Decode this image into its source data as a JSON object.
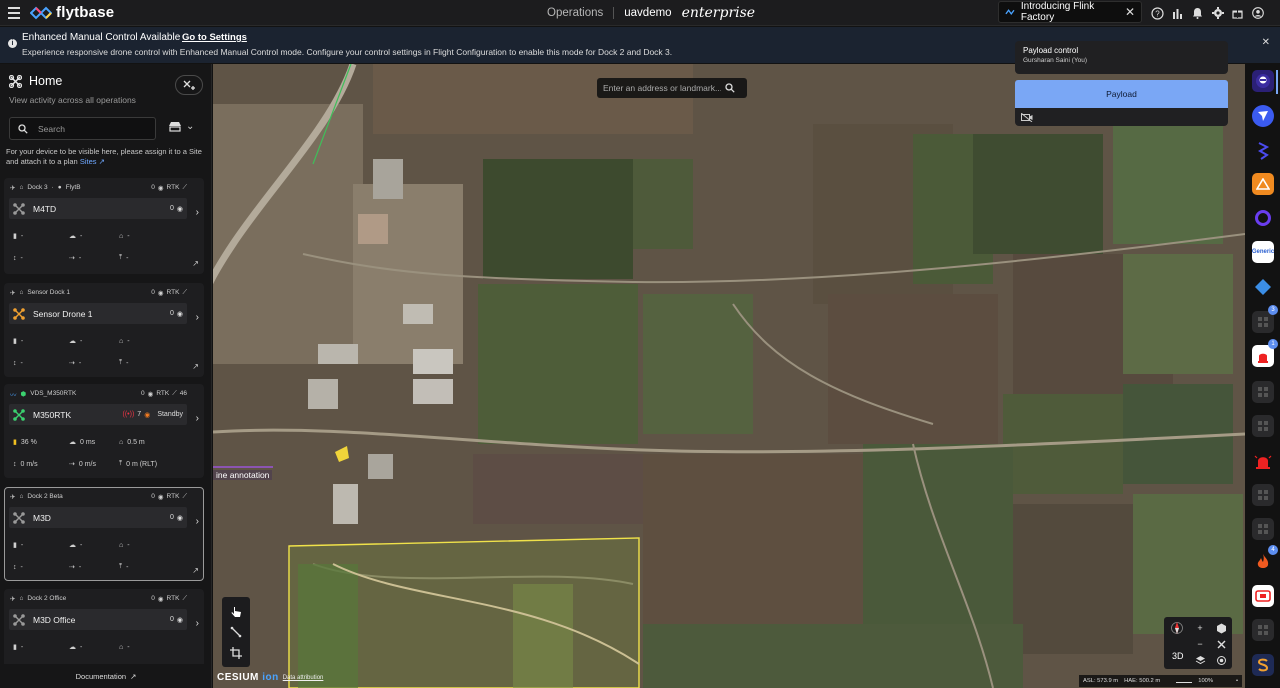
{
  "header": {
    "brand": "flytbase",
    "nav_operations": "Operations",
    "org": "uavdemo",
    "edition": "enterprise",
    "announcement": "Introducing Flink Factory"
  },
  "banner": {
    "title": "Enhanced Manual Control Available",
    "link": "Go to Settings",
    "body": "Experience responsive drone control with Enhanced Manual Control mode. Configure your control settings in Flight Configuration to enable this mode for Dock 2 and Dock 3."
  },
  "sidebar": {
    "title": "Home",
    "subtitle": "View activity across all operations",
    "search_placeholder": "Search",
    "note": "For your device to be visible here, please assign it to a Site and attach it to a plan",
    "note_link": "Sites",
    "footer": "Documentation",
    "cards": [
      {
        "dock": "Dock 3",
        "site": "FlytB",
        "count": "0",
        "rtk": "RTK",
        "rtk_value": "",
        "drone": "M4TD",
        "drone_count": "0",
        "battery": "-",
        "wind": "-",
        "altitude_icon": "-",
        "vspeed": "-",
        "hspeed": "-",
        "height": "-",
        "selected": false
      },
      {
        "dock": "Sensor Dock 1",
        "site": "",
        "count": "0",
        "rtk": "RTK",
        "rtk_value": "",
        "drone": "Sensor Drone 1",
        "drone_count": "0",
        "battery": "-",
        "wind": "-",
        "altitude_icon": "-",
        "vspeed": "-",
        "hspeed": "-",
        "height": "-",
        "selected": false
      },
      {
        "dock": "VDS_M350RTK",
        "site": "",
        "count": "0",
        "rtk": "RTK",
        "rtk_value": "46",
        "drone": "M350RTK",
        "drone_count": "7",
        "status": "Standby",
        "battery": "36 %",
        "wind": "0 ms",
        "altitude_icon": "0.5 m",
        "vspeed": "0 m/s",
        "hspeed": "0 m/s",
        "height": "0 m (RLT)",
        "selected": false
      },
      {
        "dock": "Dock 2 Beta",
        "site": "",
        "count": "0",
        "rtk": "RTK",
        "rtk_value": "",
        "drone": "M3D",
        "drone_count": "0",
        "battery": "-",
        "wind": "-",
        "altitude_icon": "-",
        "vspeed": "-",
        "hspeed": "-",
        "height": "-",
        "selected": true
      },
      {
        "dock": "Dock 2 Office",
        "site": "",
        "count": "0",
        "rtk": "RTK",
        "rtk_value": "",
        "drone": "M3D Office",
        "drone_count": "0",
        "battery": "-",
        "wind": "-",
        "altitude_icon": "-",
        "vspeed": "-",
        "hspeed": "-",
        "height": "-",
        "selected": false
      }
    ]
  },
  "map": {
    "search_placeholder": "Enter an address or landmark...",
    "annotation_label": "ine annotation",
    "attribution": "Data attribution",
    "cesium_logo": "CESIUM",
    "cesium_ion": "ion",
    "mode_label": "3D",
    "asl": "ASL: 573.9 m",
    "hae": "HAE: 500.2 m",
    "zoom": "100%"
  },
  "payload": {
    "title": "Payload control",
    "user": "Gursharan Saini (You)",
    "button": "Payload"
  },
  "rail": {
    "badges": [
      "3",
      "1",
      "4"
    ],
    "generic_label": "Generic"
  },
  "colors": {
    "accent": "#7aa7f5",
    "banner_bg": "#1b2330",
    "panel_bg": "#161617",
    "polygon": "#f0e24a"
  }
}
